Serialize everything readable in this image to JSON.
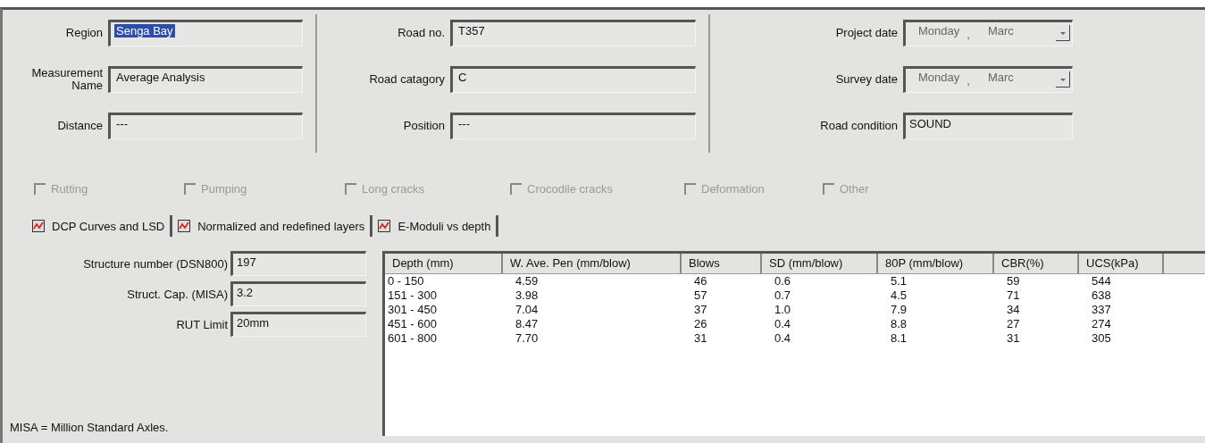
{
  "columns": [
    {
      "fields": [
        {
          "label": "Region",
          "value": "Senga Bay",
          "highlighted": true
        },
        {
          "label": "Measurement Name",
          "value": "Average Analysis",
          "highlighted": false
        },
        {
          "label": "Distance",
          "value": "---",
          "highlighted": false
        }
      ]
    },
    {
      "fields": [
        {
          "label": "Road no.",
          "value": "T357",
          "highlighted": false
        },
        {
          "label": "Road catagory",
          "value": "C",
          "highlighted": false
        },
        {
          "label": "Position",
          "value": "---",
          "highlighted": false
        }
      ]
    }
  ],
  "dates": [
    {
      "label": "Project date",
      "day": "Monday",
      "separator": ",",
      "month": "Marc"
    },
    {
      "label": "Survey date",
      "day": "Monday",
      "separator": ",",
      "month": "Marc"
    }
  ],
  "road_condition": {
    "label": "Road condition",
    "value": "SOUND"
  },
  "defects": [
    {
      "label": "Rutting",
      "checked": false,
      "disabled": true
    },
    {
      "label": "Pumping",
      "checked": false,
      "disabled": true
    },
    {
      "label": "Long cracks",
      "checked": false,
      "disabled": true
    },
    {
      "label": "Crocodile cracks",
      "checked": false,
      "disabled": true
    },
    {
      "label": "Deformation",
      "checked": false,
      "disabled": true
    },
    {
      "label": "Other",
      "checked": false,
      "disabled": true
    }
  ],
  "tabs": [
    {
      "label": "DCP Curves and LSD"
    },
    {
      "label": "Normalized and redefined layers"
    },
    {
      "label": "E-Moduli vs depth"
    }
  ],
  "summary": [
    {
      "label": "Structure number (DSN800)",
      "value": "197"
    },
    {
      "label": "Struct. Cap. (MISA)",
      "value": "3.2"
    },
    {
      "label": "RUT Limit",
      "value": "20mm"
    }
  ],
  "note": "MISA = Million Standard Axles.",
  "table": {
    "columns": [
      "Depth (mm)",
      "W. Ave. Pen (mm/blow)",
      "Blows",
      "SD (mm/blow)",
      "80P (mm/blow)",
      "CBR(%)",
      "UCS(kPa)"
    ],
    "rows": [
      [
        "0 - 150",
        "4.59",
        "46",
        "0.6",
        "5.1",
        "59",
        "544"
      ],
      [
        "151 - 300",
        "3.98",
        "57",
        "0.7",
        "4.5",
        "71",
        "638"
      ],
      [
        "301 - 450",
        "7.04",
        "37",
        "1.0",
        "7.9",
        "34",
        "337"
      ],
      [
        "451 - 600",
        "8.47",
        "26",
        "0.4",
        "8.8",
        "27",
        "274"
      ],
      [
        "601 - 800",
        "7.70",
        "31",
        "0.4",
        "8.1",
        "31",
        "305"
      ]
    ]
  }
}
